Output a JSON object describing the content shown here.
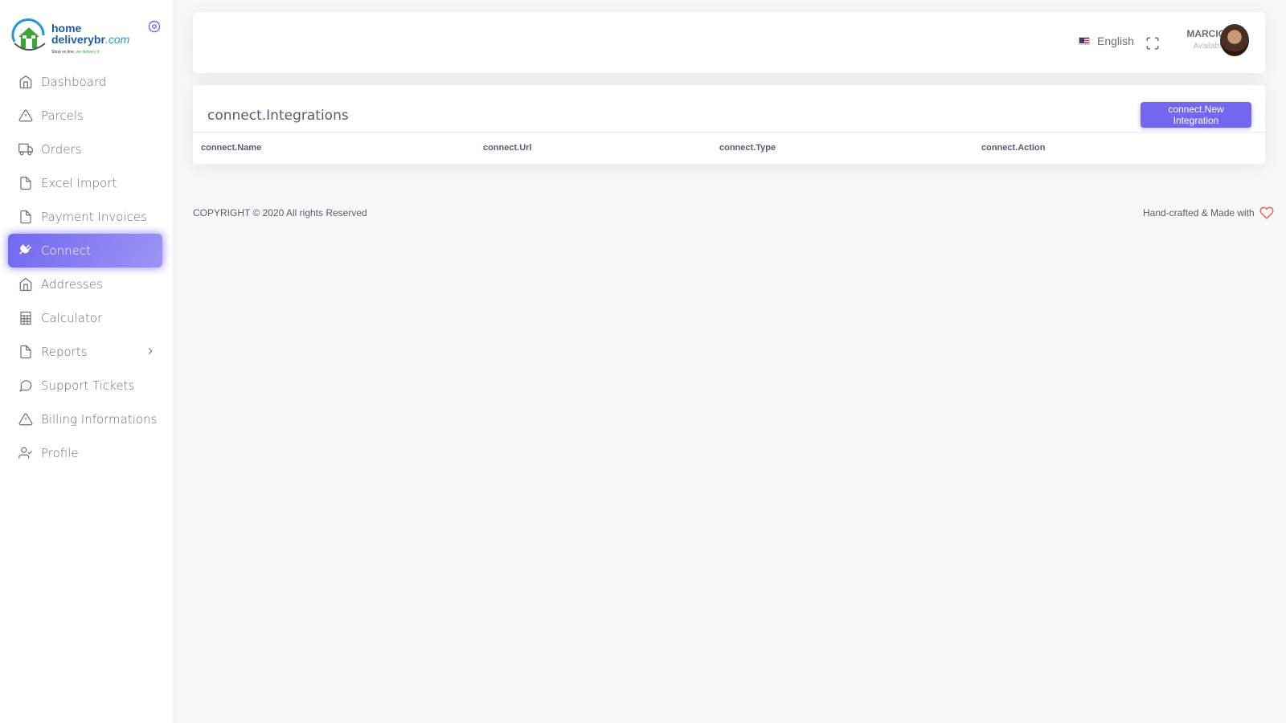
{
  "brand": {
    "line1": "home",
    "line2": "deliverybr",
    "line2_suffix": ".com",
    "tagline_a": "Shop on line, ",
    "tagline_b": "we delivery it"
  },
  "sidebar": {
    "items": [
      {
        "label": "Dashboard",
        "icon": "home-icon"
      },
      {
        "label": "Parcels",
        "icon": "alert-triangle-icon"
      },
      {
        "label": "Orders",
        "icon": "truck-icon"
      },
      {
        "label": "Excel Import",
        "icon": "file-icon"
      },
      {
        "label": "Payment Invoices",
        "icon": "file-icon"
      },
      {
        "label": "Connect",
        "icon": "plug-icon",
        "active": true
      },
      {
        "label": "Addresses",
        "icon": "home-icon"
      },
      {
        "label": "Calculator",
        "icon": "calculator-icon"
      },
      {
        "label": "Reports",
        "icon": "file-icon",
        "has_submenu": true
      },
      {
        "label": "Support Tickets",
        "icon": "message-circle-icon"
      },
      {
        "label": "Billing Informations",
        "icon": "alert-triangle-icon"
      },
      {
        "label": "Profile",
        "icon": "user-check-icon"
      }
    ]
  },
  "header": {
    "language": "English",
    "user_name": "MARCIO",
    "user_status": "Available"
  },
  "card": {
    "title": "connect.Integrations",
    "new_button": "connect.New Integration",
    "columns": [
      "connect.Name",
      "connect.Url",
      "connect.Type",
      "connect.Action"
    ]
  },
  "footer": {
    "copyright": "COPYRIGHT © 2020 All rights Reserved",
    "crafted": "Hand-crafted & Made with"
  },
  "colors": {
    "primary": "#7367f0",
    "heart": "#ea5455"
  }
}
